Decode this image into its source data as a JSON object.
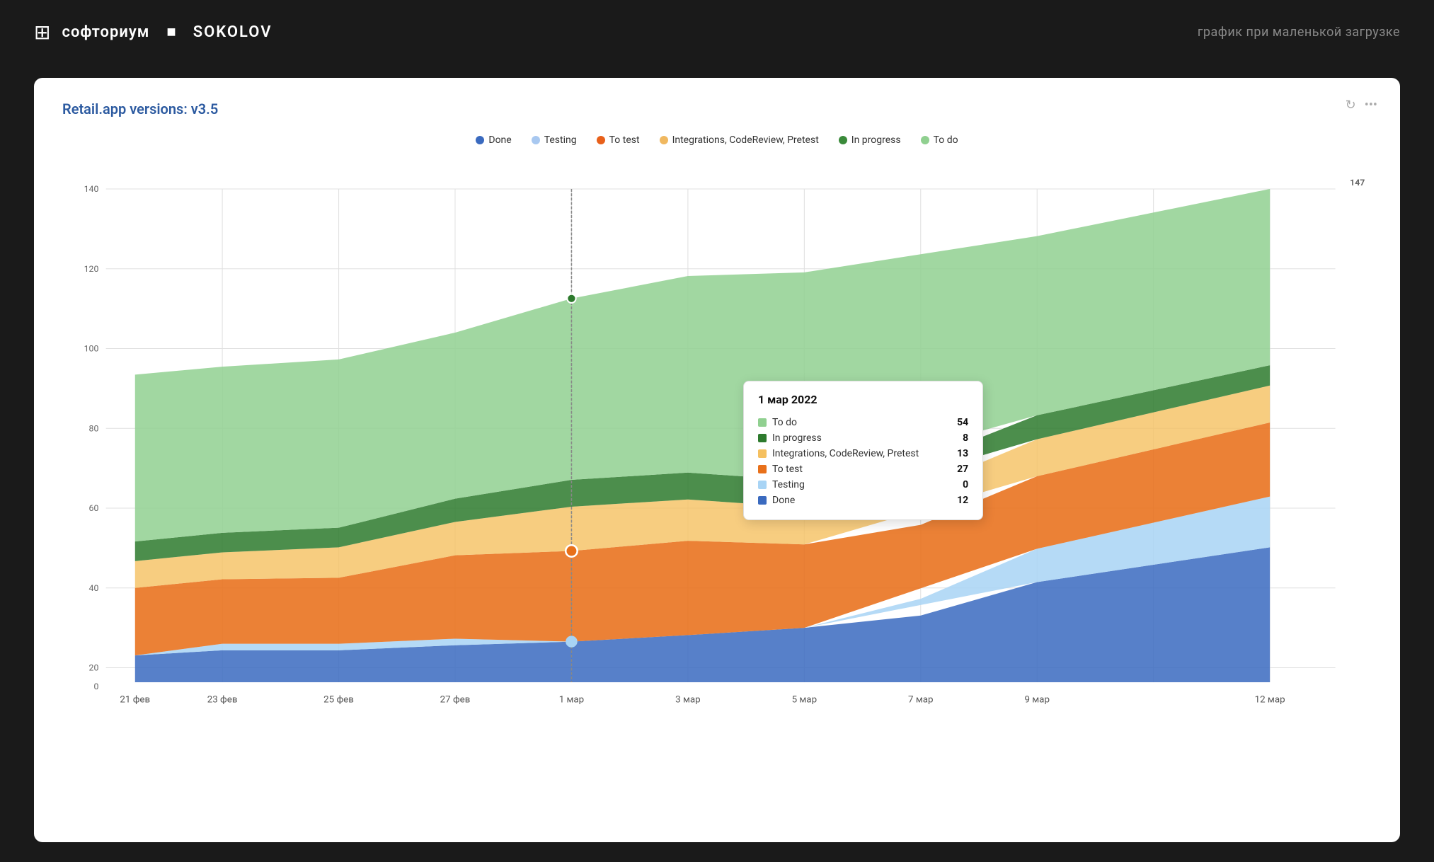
{
  "header": {
    "logo_icon": "⊞",
    "brand_name": "софториум",
    "separator": "■",
    "brand_sub": "SOKOLOV",
    "subtitle": "график при маленькой загрузке"
  },
  "chart": {
    "title": "Retail.app versions: v3.5",
    "legend": [
      {
        "label": "Done",
        "color": "#3a6abf"
      },
      {
        "label": "Testing",
        "color": "#a8c8f0"
      },
      {
        "label": "To test",
        "color": "#e8601a"
      },
      {
        "label": "Integrations, CodeReview, Pretest",
        "color": "#f0b860"
      },
      {
        "label": "In progress",
        "color": "#3a8a3a"
      },
      {
        "label": "To do",
        "color": "#90d090"
      }
    ],
    "x_labels": [
      "21 фев",
      "23 фев",
      "25 фев",
      "27 фев",
      "1 мар",
      "3 мар",
      "5 мар",
      "7 мар",
      "9 мар",
      "12 мар"
    ],
    "y_labels": [
      "0",
      "20",
      "40",
      "60",
      "80",
      "100",
      "120",
      "140",
      "147"
    ],
    "tooltip": {
      "date": "1 мар 2022",
      "rows": [
        {
          "label": "To do",
          "color": "#90d090",
          "value": "54"
        },
        {
          "label": "In progress",
          "color": "#3a8a3a",
          "value": "8"
        },
        {
          "label": "Integrations, CodeReview, Pretest",
          "color": "#f0b860",
          "value": "13"
        },
        {
          "label": "To test",
          "color": "#e8601a",
          "value": "27"
        },
        {
          "label": "Testing",
          "color": "#a8c8f0",
          "value": "0"
        },
        {
          "label": "Done",
          "color": "#3a6abf",
          "value": "12"
        }
      ]
    }
  }
}
